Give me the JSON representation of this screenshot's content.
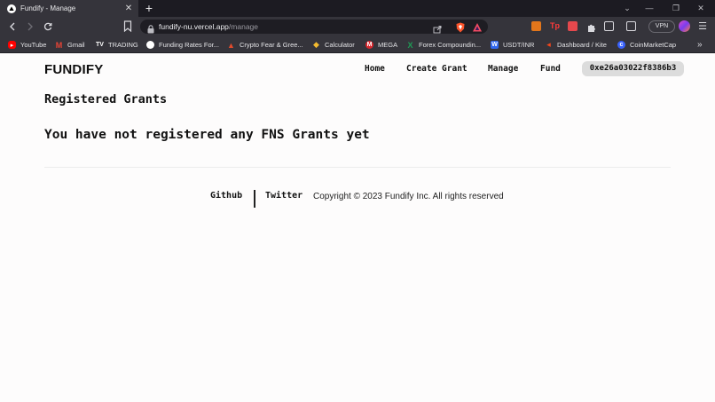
{
  "browser": {
    "tab_title": "Fundify - Manage",
    "url_host": "fundify-nu.vercel.app",
    "url_path": "/manage",
    "vpn_label": "VPN",
    "bookmarks": [
      {
        "label": "YouTube",
        "icon": "youtube-icon",
        "color": "#ff0000"
      },
      {
        "label": "Gmail",
        "icon": "gmail-icon",
        "color": "#ea4335"
      },
      {
        "label": "TRADING",
        "icon": "tradingview-icon",
        "color": "#ffffff"
      },
      {
        "label": "Funding Rates For...",
        "icon": "shield-icon",
        "color": "#ffffff"
      },
      {
        "label": "Crypto Fear & Gree...",
        "icon": "triangle-icon",
        "color": "#e14b2d"
      },
      {
        "label": "Calculator",
        "icon": "binance-icon",
        "color": "#f3ba2f"
      },
      {
        "label": "MEGA",
        "icon": "mega-icon",
        "color": "#d9272e"
      },
      {
        "label": "Forex Compoundin...",
        "icon": "x-icon",
        "color": "#1f9d55"
      },
      {
        "label": "USDT/INR",
        "icon": "wazirx-icon",
        "color": "#3067f0"
      },
      {
        "label": "Dashboard / Kite",
        "icon": "kite-icon",
        "color": "#f6461a"
      },
      {
        "label": "CoinMarketCap",
        "icon": "coinmarketcap-icon",
        "color": "#3861fb"
      }
    ]
  },
  "app": {
    "brand": "FUNDIFY",
    "nav": {
      "home": "Home",
      "create_grant": "Create Grant",
      "manage": "Manage",
      "fund": "Fund"
    },
    "wallet_address": "0xe26a03022f8386b3"
  },
  "main": {
    "heading": "Registered Grants",
    "empty_message": "You have not registered any FNS Grants yet"
  },
  "footer": {
    "github": "Github",
    "twitter": "Twitter",
    "copyright": "Copyright © 2023 Fundify Inc. All rights reserved"
  }
}
